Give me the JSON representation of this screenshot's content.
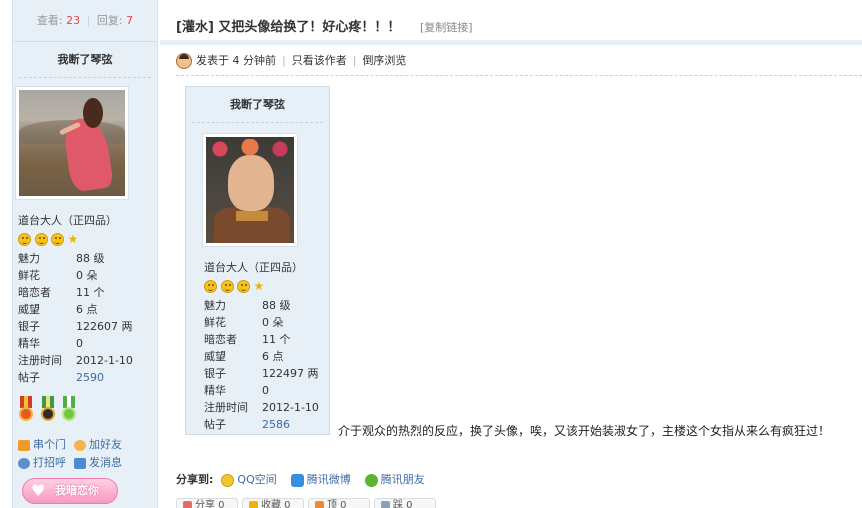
{
  "stats": {
    "views_label": "查看:",
    "views": "23",
    "replies_label": "回复:",
    "replies": "7"
  },
  "thread": {
    "title": "[灌水] 又把头像给换了！好心疼！！！",
    "copy_link": "[复制链接]"
  },
  "meta": {
    "posted": "发表于 4 分钟前",
    "author_only": "只看该作者",
    "reverse": "倒序浏览"
  },
  "left_profile": {
    "name": "我断了琴弦",
    "rank": "道台大人（正四品）",
    "rows": [
      {
        "k": "魅力",
        "v": "88 级"
      },
      {
        "k": "鲜花",
        "v": "0 朵"
      },
      {
        "k": "暗恋者",
        "v": "11 个"
      },
      {
        "k": "威望",
        "v": "6 点"
      },
      {
        "k": "银子",
        "v": "122607 两"
      },
      {
        "k": "精华",
        "v": "0"
      },
      {
        "k": "注册时间",
        "v": "2012-1-10"
      },
      {
        "k": "帖子",
        "v": "2590"
      }
    ],
    "actions": {
      "visit": "串个门",
      "add_friend": "加好友",
      "greet": "打招呼",
      "message": "发消息"
    },
    "love_button": "我暗恋你"
  },
  "card_profile": {
    "name": "我断了琴弦",
    "rank": "道台大人（正四品）",
    "rows": [
      {
        "k": "魅力",
        "v": "88 级"
      },
      {
        "k": "鲜花",
        "v": "0 朵"
      },
      {
        "k": "暗恋者",
        "v": "11 个"
      },
      {
        "k": "威望",
        "v": "6 点"
      },
      {
        "k": "银子",
        "v": "122497 两"
      },
      {
        "k": "精华",
        "v": "0"
      },
      {
        "k": "注册时间",
        "v": "2012-1-10"
      },
      {
        "k": "帖子",
        "v": "2586"
      }
    ]
  },
  "post_text": "介于观众的热烈的反应，换了头像，唉，又该开始装淑女了，主楼这个女指从来么有疯狂过！",
  "share": {
    "label": "分享到:",
    "services": [
      "QQ空间",
      "腾讯微博",
      "腾讯朋友"
    ]
  },
  "votes": [
    "分享 0",
    "收藏 0",
    "顶 0",
    "踩 0"
  ],
  "colors": {
    "accent_red": "#e4474b",
    "link_blue": "#3c6ba8",
    "sidebar_bg": "#e8f0f7"
  },
  "icons": [
    "smile-icon",
    "star-icon",
    "medal-icon",
    "house-icon",
    "friend-icon",
    "greet-icon",
    "mail-icon",
    "heart-icon",
    "qzone-icon",
    "weibo-icon",
    "pengyou-icon"
  ]
}
